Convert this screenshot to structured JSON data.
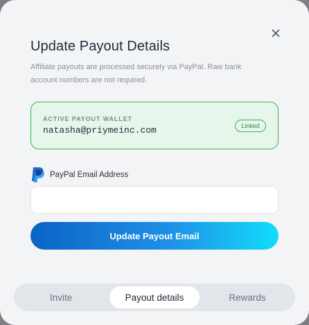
{
  "modal": {
    "title": "Update Payout Details",
    "subtitle": "Affiliate payouts are processed securely via PayPal. Raw bank account numbers are not required.",
    "close_icon": "close-icon"
  },
  "wallet": {
    "label": "ACTIVE PAYOUT WALLET",
    "email": "natasha@priymeinc.com",
    "status_badge": "Linked"
  },
  "paypal_field": {
    "icon": "paypal-icon",
    "label": "PayPal Email Address",
    "value": "",
    "placeholder": ""
  },
  "submit_button": {
    "label": "Update Payout Email"
  },
  "tabs": [
    {
      "label": "Invite",
      "active": false
    },
    {
      "label": "Payout details",
      "active": true
    },
    {
      "label": "Rewards",
      "active": false
    }
  ],
  "colors": {
    "accent_green": "#35b255",
    "wallet_bg": "#e6f6ea",
    "button_gradient_start": "#0a63c6",
    "button_gradient_end": "#12dcfa",
    "modal_bg": "#f3f4f6"
  }
}
